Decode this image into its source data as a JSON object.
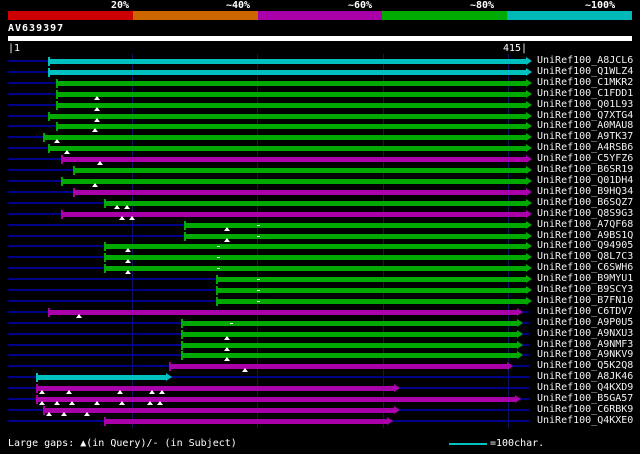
{
  "colors": {
    "background": "#000000",
    "baseline": "#000088",
    "grid": "#12125e",
    "text": "#ffffff",
    "query_bar": "#ffffff",
    "gap_marker": "#ffffff",
    "green": "#00aa00",
    "magenta": "#aa00aa",
    "cyan": "#00c0c0",
    "scale_line": "#00c0c0"
  },
  "footer": {
    "gaps_note": "Large gaps: ▲(in Query)/- (in Subject)",
    "scale_label": "=100char."
  },
  "chart_data": {
    "type": "bar",
    "orientation": "horizontal",
    "title": "AV639397",
    "query": {
      "name": "AV639397",
      "length": 415,
      "start_label": "|1",
      "end_label": "415|"
    },
    "x_range": [
      1,
      415
    ],
    "gridlines": [
      100,
      200,
      300,
      400
    ],
    "legend": {
      "position": "top",
      "labels": [
        "20%",
        "~40%",
        "~60%",
        "~80%",
        "~100%"
      ],
      "colors": [
        "#cc0000",
        "#cc6600",
        "#aa00aa",
        "#00aa00",
        "#00b8b8"
      ]
    },
    "hits": [
      {
        "label": "UniRef100_A8JCL6",
        "color": "cyan",
        "identity": "~100%",
        "start": 34,
        "end": 415,
        "query_gaps": [],
        "subject_gaps": []
      },
      {
        "label": "UniRef100_Q1WLZ4",
        "color": "cyan",
        "identity": "~100%",
        "start": 34,
        "end": 415,
        "query_gaps": [],
        "subject_gaps": []
      },
      {
        "label": "UniRef100_C1MKR2",
        "color": "green",
        "identity": "~80%",
        "start": 40,
        "end": 415,
        "query_gaps": [],
        "subject_gaps": []
      },
      {
        "label": "UniRef100_C1FDD1",
        "color": "green",
        "identity": "~80%",
        "start": 40,
        "end": 415,
        "query_gaps": [
          72
        ],
        "subject_gaps": []
      },
      {
        "label": "UniRef100_Q01L93",
        "color": "green",
        "identity": "~80%",
        "start": 40,
        "end": 415,
        "query_gaps": [
          72
        ],
        "subject_gaps": []
      },
      {
        "label": "UniRef100_Q7XTG4",
        "color": "green",
        "identity": "~80%",
        "start": 34,
        "end": 415,
        "query_gaps": [
          72
        ],
        "subject_gaps": []
      },
      {
        "label": "UniRef100_A0MAU8",
        "color": "green",
        "identity": "~80%",
        "start": 40,
        "end": 415,
        "query_gaps": [
          70
        ],
        "subject_gaps": []
      },
      {
        "label": "UniRef100_A9TK37",
        "color": "green",
        "identity": "~80%",
        "start": 30,
        "end": 415,
        "query_gaps": [
          40
        ],
        "subject_gaps": []
      },
      {
        "label": "UniRef100_A4RSB6",
        "color": "green",
        "identity": "~80%",
        "start": 34,
        "end": 415,
        "query_gaps": [
          48
        ],
        "subject_gaps": []
      },
      {
        "label": "UniRef100_C5YFZ6",
        "color": "magenta",
        "identity": "~60%",
        "start": 44,
        "end": 415,
        "query_gaps": [
          74
        ],
        "subject_gaps": []
      },
      {
        "label": "UniRef100_B6SR19",
        "color": "green",
        "identity": "~80%",
        "start": 54,
        "end": 415,
        "query_gaps": [],
        "subject_gaps": []
      },
      {
        "label": "UniRef100_Q01DH4",
        "color": "green",
        "identity": "~80%",
        "start": 44,
        "end": 415,
        "query_gaps": [
          70
        ],
        "subject_gaps": []
      },
      {
        "label": "UniRef100_B9HQ34",
        "color": "magenta",
        "identity": "~60%",
        "start": 54,
        "end": 415,
        "query_gaps": [],
        "subject_gaps": []
      },
      {
        "label": "UniRef100_B6SQZ7",
        "color": "green",
        "identity": "~80%",
        "start": 78,
        "end": 415,
        "query_gaps": [
          88,
          96
        ],
        "subject_gaps": []
      },
      {
        "label": "UniRef100_Q8S9G3",
        "color": "magenta",
        "identity": "~60%",
        "start": 44,
        "end": 415,
        "query_gaps": [
          92,
          100
        ],
        "subject_gaps": []
      },
      {
        "label": "UniRef100_A7QF68",
        "color": "green",
        "identity": "~80%",
        "start": 142,
        "end": 415,
        "query_gaps": [
          176
        ],
        "subject_gaps": [
          200
        ]
      },
      {
        "label": "UniRef100_A9BS1Q",
        "color": "green",
        "identity": "~80%",
        "start": 142,
        "end": 415,
        "query_gaps": [
          176
        ],
        "subject_gaps": [
          200
        ]
      },
      {
        "label": "UniRef100_Q94905",
        "color": "green",
        "identity": "~80%",
        "start": 78,
        "end": 415,
        "query_gaps": [
          97
        ],
        "subject_gaps": [
          168
        ]
      },
      {
        "label": "UniRef100_Q8L7C3",
        "color": "green",
        "identity": "~80%",
        "start": 78,
        "end": 415,
        "query_gaps": [
          97
        ],
        "subject_gaps": [
          168
        ]
      },
      {
        "label": "UniRef100_C6SWH6",
        "color": "green",
        "identity": "~80%",
        "start": 78,
        "end": 415,
        "query_gaps": [
          97
        ],
        "subject_gaps": [
          168
        ]
      },
      {
        "label": "UniRef100_B9MYU1",
        "color": "green",
        "identity": "~80%",
        "start": 168,
        "end": 415,
        "query_gaps": [],
        "subject_gaps": [
          200
        ]
      },
      {
        "label": "UniRef100_B9SCY3",
        "color": "green",
        "identity": "~80%",
        "start": 168,
        "end": 415,
        "query_gaps": [],
        "subject_gaps": [
          200
        ]
      },
      {
        "label": "UniRef100_B7FN10",
        "color": "green",
        "identity": "~80%",
        "start": 168,
        "end": 415,
        "query_gaps": [],
        "subject_gaps": [
          200
        ]
      },
      {
        "label": "UniRef100_C6TDV7",
        "color": "magenta",
        "identity": "~60%",
        "start": 34,
        "end": 408,
        "query_gaps": [
          58
        ],
        "subject_gaps": []
      },
      {
        "label": "UniRef100_A9P0U5",
        "color": "green",
        "identity": "~80%",
        "start": 140,
        "end": 408,
        "query_gaps": [],
        "subject_gaps": [
          178
        ]
      },
      {
        "label": "UniRef100_A9NXU3",
        "color": "green",
        "identity": "~80%",
        "start": 140,
        "end": 408,
        "query_gaps": [
          176
        ],
        "subject_gaps": []
      },
      {
        "label": "UniRef100_A9NMF3",
        "color": "green",
        "identity": "~80%",
        "start": 140,
        "end": 408,
        "query_gaps": [
          176
        ],
        "subject_gaps": []
      },
      {
        "label": "UniRef100_A9NKV9",
        "color": "green",
        "identity": "~80%",
        "start": 140,
        "end": 408,
        "query_gaps": [
          176
        ],
        "subject_gaps": []
      },
      {
        "label": "UniRef100_Q5K2Q8",
        "color": "magenta",
        "identity": "~60%",
        "start": 130,
        "end": 400,
        "query_gaps": [
          190
        ],
        "subject_gaps": []
      },
      {
        "label": "UniRef100_A8JK46",
        "color": "cyan",
        "identity": "~100%",
        "start": 24,
        "end": 128,
        "query_gaps": [],
        "subject_gaps": []
      },
      {
        "label": "UniRef100_Q4KXD9",
        "color": "magenta",
        "identity": "~60%",
        "start": 24,
        "end": 310,
        "query_gaps": [
          28,
          50,
          90,
          116,
          124
        ],
        "subject_gaps": []
      },
      {
        "label": "UniRef100_B5GA57",
        "color": "magenta",
        "identity": "~60%",
        "start": 24,
        "end": 406,
        "query_gaps": [
          28,
          40,
          52,
          72,
          92,
          114,
          122
        ],
        "subject_gaps": []
      },
      {
        "label": "UniRef100_C6RBK9",
        "color": "magenta",
        "identity": "~60%",
        "start": 30,
        "end": 310,
        "query_gaps": [
          34,
          46,
          64
        ],
        "subject_gaps": []
      },
      {
        "label": "UniRef100_Q4KXE0",
        "color": "magenta",
        "identity": "~60%",
        "start": 78,
        "end": 304,
        "query_gaps": [],
        "subject_gaps": []
      }
    ]
  }
}
